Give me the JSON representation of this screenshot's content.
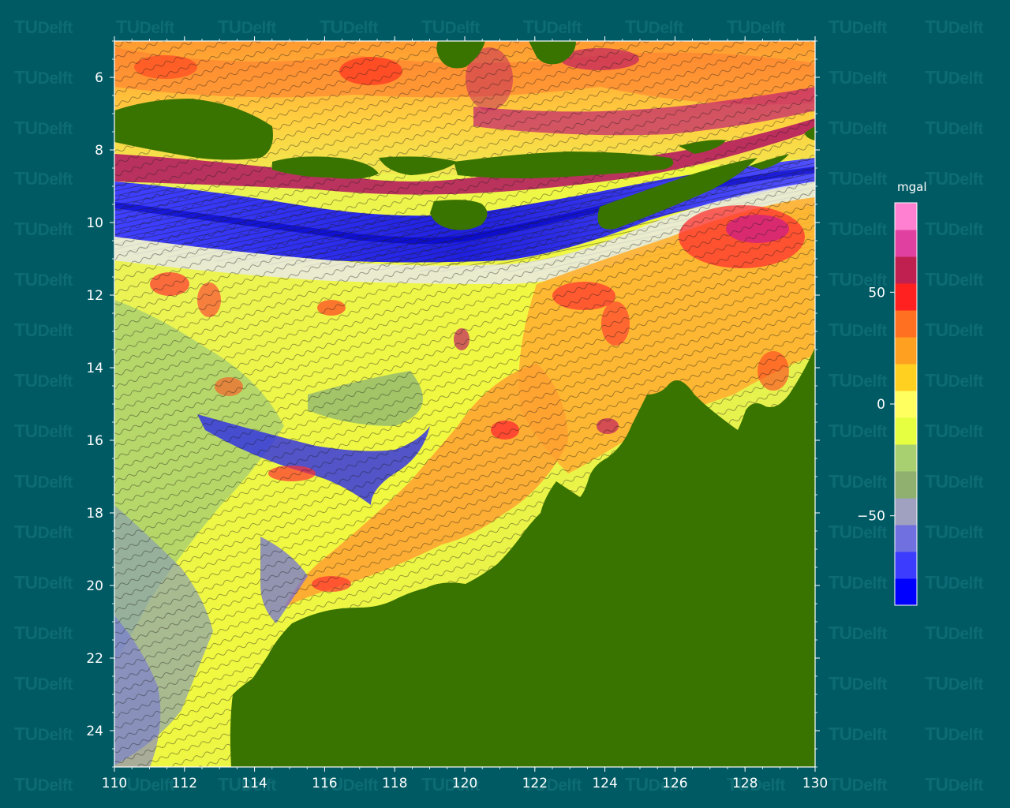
{
  "watermark": {
    "brand": "TU",
    "brand_rest": "Delft"
  },
  "map": {
    "x_axis": {
      "ticks": [
        "110",
        "112",
        "114",
        "116",
        "118",
        "120",
        "122",
        "124",
        "126",
        "128",
        "130"
      ],
      "range": [
        110,
        130
      ]
    },
    "y_axis": {
      "ticks": [
        "6",
        "8",
        "10",
        "12",
        "14",
        "16",
        "18",
        "20",
        "22",
        "24"
      ],
      "range": [
        5,
        25
      ],
      "inverted": true
    },
    "land_color": "#3a7400",
    "ocean_background": "#005a64"
  },
  "colorbar": {
    "unit": "mgal",
    "ticks": [
      "50",
      "0",
      "−50"
    ],
    "range": [
      -90,
      90
    ],
    "colors": [
      "#0000ff",
      "#3c3cff",
      "#7070e0",
      "#a0a0c0",
      "#90b070",
      "#a8d070",
      "#e6ff40",
      "#ffff60",
      "#ffd020",
      "#ffa020",
      "#ff7020",
      "#ff2020",
      "#c02050",
      "#e040a0",
      "#ff80d0"
    ]
  }
}
